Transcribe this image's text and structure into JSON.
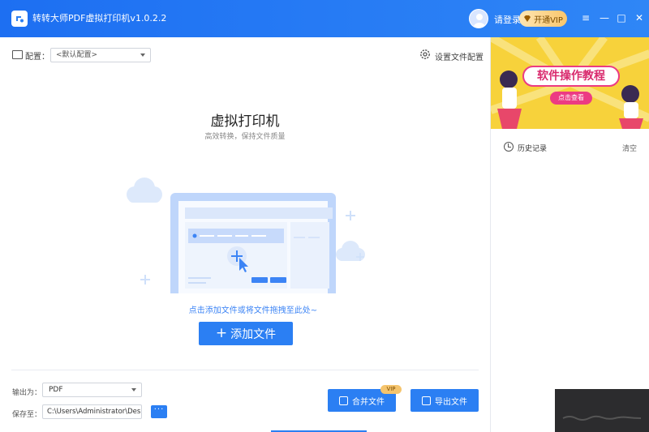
{
  "titlebar": {
    "app_title": "转转大师PDF虚拟打印机v1.0.2.2",
    "login": "请登录",
    "vip_label": "开通VIP",
    "menu_icon": "≡",
    "minimize_icon": "—",
    "maximize_icon": "□",
    "close_icon": "✕",
    "accent": "#2f86f6"
  },
  "config": {
    "label": "配置：",
    "selected": "<默认配置>",
    "settings_label": "设置文件配置"
  },
  "main": {
    "title": "虚拟打印机",
    "subtitle": "高效转换，保持文件质量",
    "drop_hint": "点击添加文件或将文件拖拽至此处~",
    "add_button": "添加文件",
    "add_button_icon": "+"
  },
  "output": {
    "format_label": "输出为：",
    "format_value": "PDF",
    "save_label": "保存至：",
    "save_path": "C:\\Users\\Administrator\\Desk...",
    "browse_label": "···",
    "merge_label": "合并文件",
    "vip_tag": "VIP",
    "export_label": "导出文件"
  },
  "sidebar": {
    "banner_title": "软件操作教程",
    "banner_cta": "点击查看",
    "history_label": "历史记录",
    "clear_label": "清空"
  }
}
